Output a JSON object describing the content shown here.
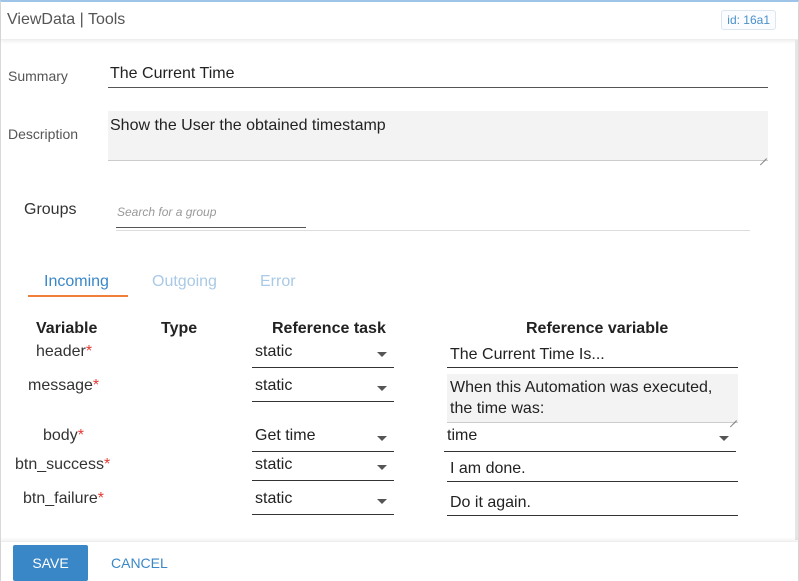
{
  "header": {
    "title": "ViewData | Tools",
    "id_badge": "id: 16a1"
  },
  "form": {
    "summary_label": "Summary",
    "summary_value": "The Current Time",
    "description_label": "Description",
    "description_value": "Show the User the obtained timestamp",
    "groups_label": "Groups",
    "groups_placeholder": "Search for a group"
  },
  "tabs": [
    {
      "label": "Incoming",
      "active": true
    },
    {
      "label": "Outgoing",
      "active": false
    },
    {
      "label": "Error",
      "active": false
    }
  ],
  "table": {
    "headers": {
      "variable": "Variable",
      "type": "Type",
      "reference_task": "Reference task",
      "reference_variable": "Reference variable"
    },
    "rows": [
      {
        "variable": "header",
        "required": "*",
        "reference_task": "static",
        "reference_variable": "The Current Time Is..."
      },
      {
        "variable": "message",
        "required": "*",
        "reference_task": "static",
        "reference_variable": "When this Automation was executed, the time was:"
      },
      {
        "variable": "body",
        "required": "*",
        "reference_task": "Get time",
        "reference_variable": "time"
      },
      {
        "variable": "btn_success",
        "required": "*",
        "reference_task": "static",
        "reference_variable": "I am done."
      },
      {
        "variable": "btn_failure",
        "required": "*",
        "reference_task": "static",
        "reference_variable": "Do it again."
      }
    ]
  },
  "footer": {
    "save_label": "SAVE",
    "cancel_label": "CANCEL"
  },
  "colors": {
    "accent": "#3a87c8",
    "tab_underline": "#ef7f3a",
    "required": "#e53935"
  }
}
